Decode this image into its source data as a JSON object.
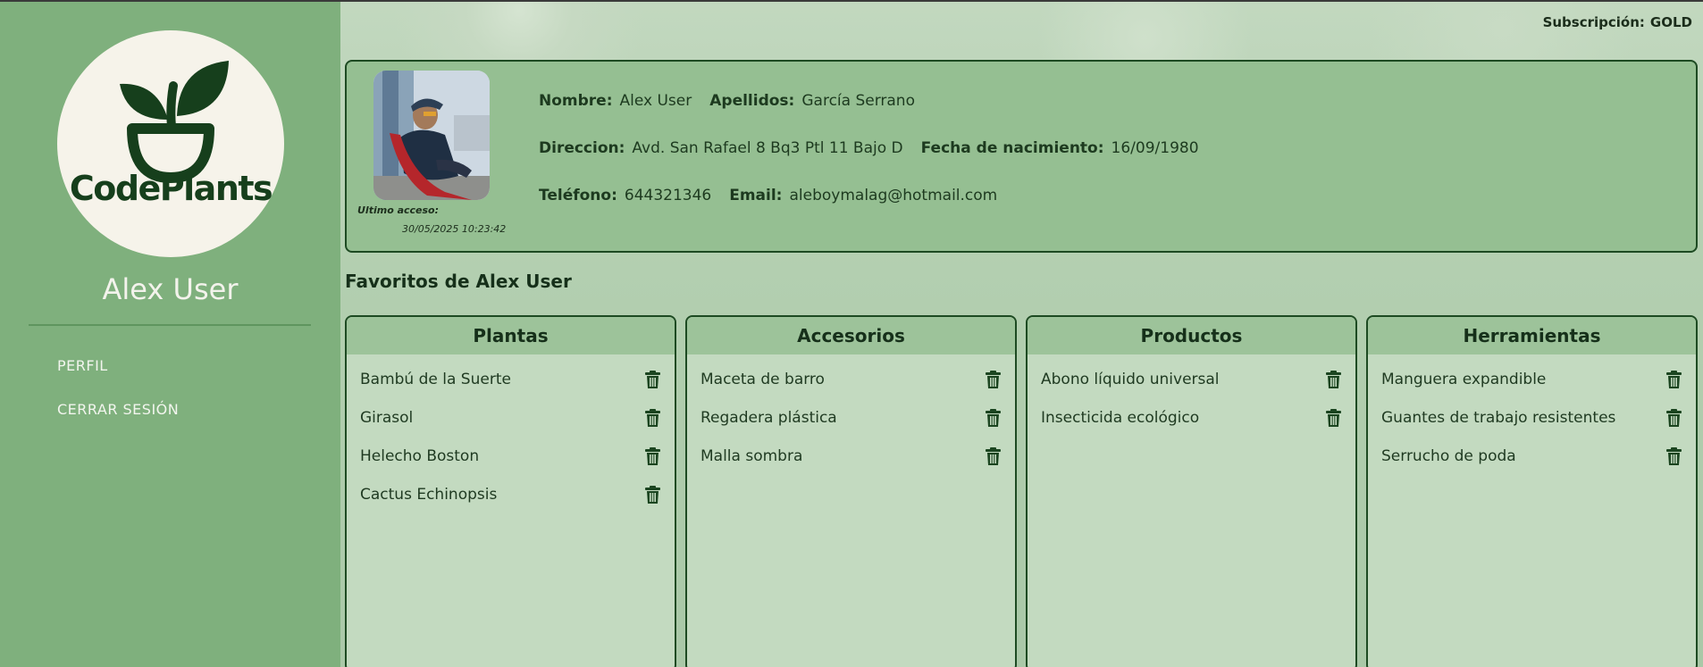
{
  "brand": {
    "name": "CodePlants"
  },
  "sidebar": {
    "username": "Alex User",
    "nav": [
      {
        "label": "PERFIL"
      },
      {
        "label": "CERRAR SESIÓN"
      }
    ]
  },
  "subscription": {
    "label": "Subscripción:",
    "value": "GOLD"
  },
  "profile": {
    "last_access_label": "Ultimo acceso:",
    "last_access_value": "30/05/2025 10:23:42",
    "nombre_label": "Nombre:",
    "nombre": "Alex User",
    "apellidos_label": "Apellidos:",
    "apellidos": "García Serrano",
    "direccion_label": "Direccion:",
    "direccion": "Avd. San Rafael 8 Bq3 Ptl 11 Bajo D",
    "nacimiento_label": "Fecha de nacimiento:",
    "nacimiento": "16/09/1980",
    "telefono_label": "Teléfono:",
    "telefono": "644321346",
    "email_label": "Email:",
    "email": "aleboymalag@hotmail.com"
  },
  "favorites": {
    "title": "Favoritos de Alex User",
    "categories": [
      {
        "name": "Plantas",
        "items": [
          "Bambú de la Suerte",
          "Girasol",
          "Helecho Boston",
          "Cactus Echinopsis"
        ]
      },
      {
        "name": "Accesorios",
        "items": [
          "Maceta de barro",
          "Regadera plástica",
          "Malla sombra"
        ]
      },
      {
        "name": "Productos",
        "items": [
          "Abono líquido universal",
          "Insecticida ecológico"
        ]
      },
      {
        "name": "Herramientas",
        "items": [
          "Manguera expandible",
          "Guantes de trabajo resistentes",
          "Serrucho de poda"
        ]
      }
    ]
  },
  "colors": {
    "sidebar": "#7fb07d",
    "accent_dark": "#1d4a22",
    "card": "#95bf92"
  },
  "icons": {
    "delete": "trash-icon",
    "logo": "plant-pot-icon"
  }
}
